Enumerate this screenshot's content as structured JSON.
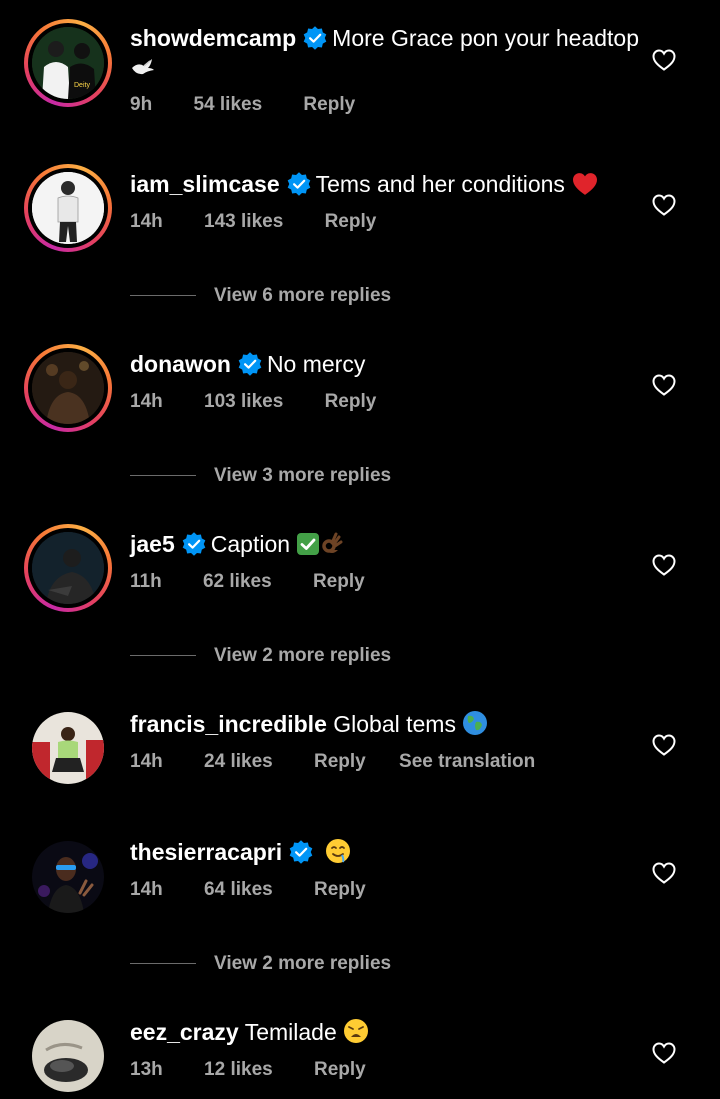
{
  "comments": [
    {
      "username": "showdemcamp",
      "verified": true,
      "text": "More Grace pon your headtop",
      "time": "9h",
      "likes": "54 likes",
      "reply": "Reply"
    },
    {
      "username": "iam_slimcase",
      "verified": true,
      "text": "Tems and her conditions",
      "time": "14h",
      "likes": "143 likes",
      "reply": "Reply",
      "view_replies": "View 6 more replies"
    },
    {
      "username": "donawon",
      "verified": true,
      "text": "No mercy",
      "time": "14h",
      "likes": "103 likes",
      "reply": "Reply",
      "view_replies": "View 3 more replies"
    },
    {
      "username": "jae5",
      "verified": true,
      "text": "Caption",
      "time": "11h",
      "likes": "62 likes",
      "reply": "Reply",
      "view_replies": "View 2 more replies"
    },
    {
      "username": "francis_incredible",
      "verified": false,
      "text": "Global tems",
      "time": "14h",
      "likes": "24 likes",
      "reply": "Reply",
      "see_translation": "See translation"
    },
    {
      "username": "thesierracapri",
      "verified": true,
      "text": "",
      "time": "14h",
      "likes": "64 likes",
      "reply": "Reply",
      "view_replies": "View 2 more replies"
    },
    {
      "username": "eez_crazy",
      "verified": false,
      "text": "Temilade",
      "time": "13h",
      "likes": "12 likes",
      "reply": "Reply"
    }
  ],
  "avatar_text": "Deity",
  "colors": {
    "background": "#000000",
    "text": "#ffffff",
    "secondary": "#a8a8a8",
    "verified_blue": "#0095f6"
  }
}
